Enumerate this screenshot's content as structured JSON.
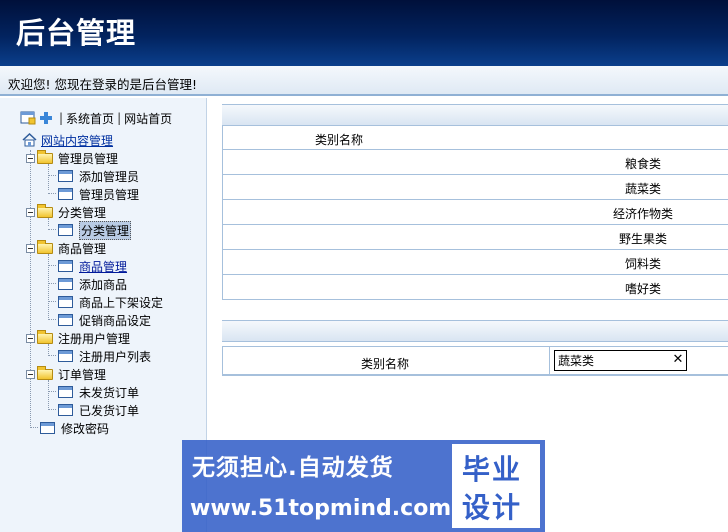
{
  "header": {
    "title": "后台管理"
  },
  "welcome": {
    "text": "欢迎您! 您现在登录的是后台管理!"
  },
  "sidebar": {
    "topnav": {
      "sep1": "|",
      "system_home": "系统首页",
      "sep2": "|",
      "site_home": "网站首页"
    },
    "root_label": "网站内容管理",
    "groups": [
      {
        "label": "管理员管理",
        "items": [
          {
            "label": "添加管理员"
          },
          {
            "label": "管理员管理"
          }
        ]
      },
      {
        "label": "分类管理",
        "items": [
          {
            "label": "分类管理"
          }
        ]
      },
      {
        "label": "商品管理",
        "items": [
          {
            "label": "商品管理"
          },
          {
            "label": "添加商品"
          },
          {
            "label": "商品上下架设定"
          },
          {
            "label": "促销商品设定"
          }
        ]
      },
      {
        "label": "注册用户管理",
        "items": [
          {
            "label": "注册用户列表"
          }
        ]
      },
      {
        "label": "订单管理",
        "items": [
          {
            "label": "未发货订单"
          },
          {
            "label": "已发货订单"
          }
        ]
      }
    ],
    "change_password": "修改密码"
  },
  "category_table": {
    "header": "类别名称",
    "rows": [
      {
        "name": "粮食类"
      },
      {
        "name": "蔬菜类"
      },
      {
        "name": "经济作物类"
      },
      {
        "name": "野生果类"
      },
      {
        "name": "饲料类"
      },
      {
        "name": "嗜好类"
      }
    ]
  },
  "edit_form": {
    "label": "类别名称",
    "value": "蔬菜类",
    "clear_icon": "✕"
  },
  "watermark": {
    "line1": "无须担心.自动发货",
    "line2": "www.51topmind.com",
    "logo_line1": "毕业",
    "logo_line2": "设计"
  },
  "colors": {
    "header_bg": "#02235f",
    "sidebar_bg": "#eef4fb",
    "table_border": "#a6c0dc",
    "watermark_bg": "#3460c8"
  },
  "icons": [
    "add-page-icon",
    "plus-icon",
    "home-icon",
    "folder-icon",
    "page-icon",
    "clear-icon"
  ]
}
